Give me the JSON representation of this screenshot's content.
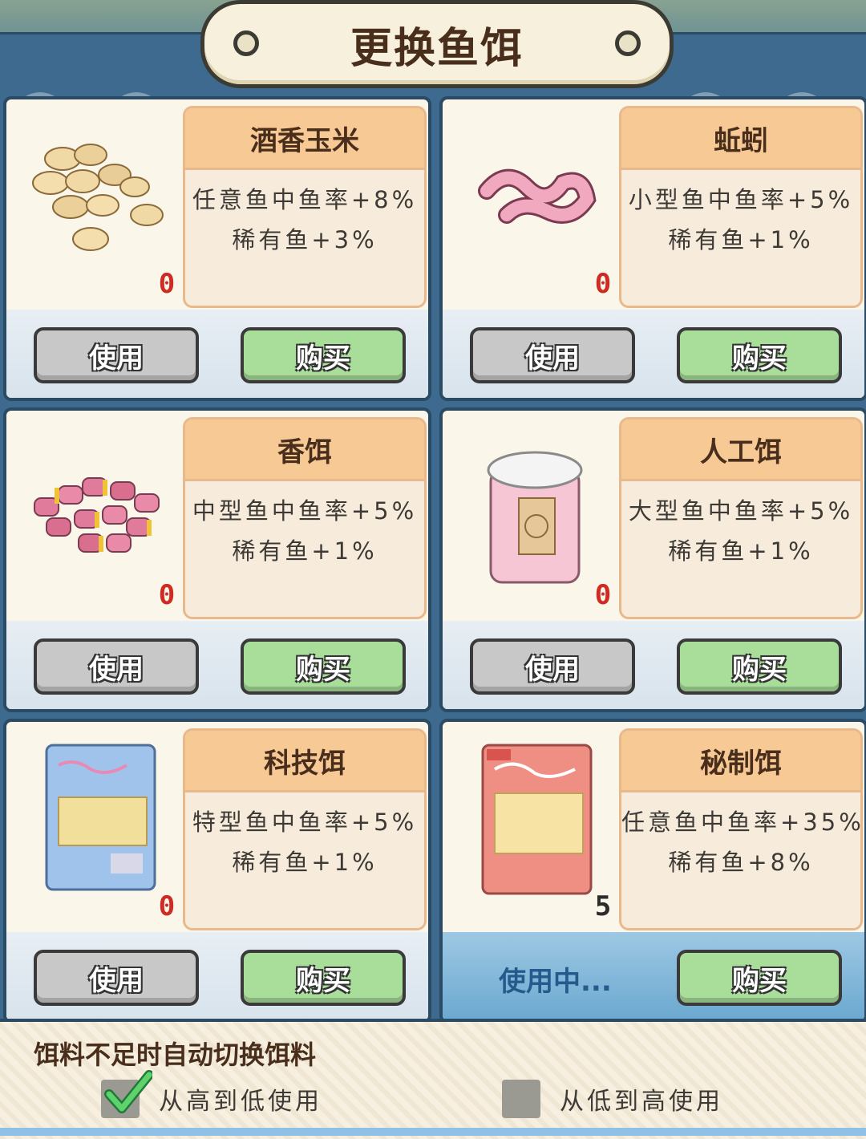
{
  "title": "更换鱼饵",
  "colors": {
    "count_zero": "#d02a25",
    "buy_button": "#a9dd9a",
    "use_button": "#c8c8c8",
    "active_footer": "#6ba8d0"
  },
  "baits": [
    {
      "name": "酒香玉米",
      "line1": "任意鱼中鱼率+8%",
      "line2": "稀有鱼+3%",
      "count": "0",
      "use_label": "使用",
      "buy_label": "购买",
      "icon": "corn-kernels-icon"
    },
    {
      "name": "蚯蚓",
      "line1": "小型鱼中鱼率+5%",
      "line2": "稀有鱼+1%",
      "count": "0",
      "use_label": "使用",
      "buy_label": "购买",
      "icon": "earthworm-icon"
    },
    {
      "name": "香饵",
      "line1": "中型鱼中鱼率+5%",
      "line2": "稀有鱼+1%",
      "count": "0",
      "use_label": "使用",
      "buy_label": "购买",
      "icon": "bait-pellets-icon"
    },
    {
      "name": "人工饵",
      "line1": "大型鱼中鱼率+5%",
      "line2": "稀有鱼+1%",
      "count": "0",
      "use_label": "使用",
      "buy_label": "购买",
      "icon": "bait-jar-icon"
    },
    {
      "name": "科技饵",
      "line1": "特型鱼中鱼率+5%",
      "line2": "稀有鱼+1%",
      "count": "0",
      "use_label": "使用",
      "buy_label": "购买",
      "icon": "blue-bait-bag-icon"
    },
    {
      "name": "秘制饵",
      "line1": "任意鱼中鱼率+35%",
      "line2": "稀有鱼+8%",
      "count": "5",
      "using_label": "使用中...",
      "buy_label": "购买",
      "icon": "red-bait-bag-icon"
    }
  ],
  "footer": {
    "label": "饵料不足时自动切换饵料",
    "option_high_to_low": "从高到低使用",
    "option_low_to_high": "从低到高使用",
    "high_to_low_checked": true,
    "low_to_high_checked": false
  }
}
